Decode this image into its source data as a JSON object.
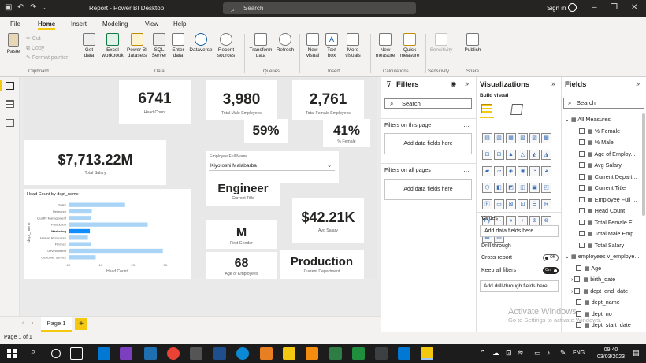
{
  "titlebar": {
    "title": "Report - Power BI Desktop",
    "search": "Search",
    "signin": "Sign in"
  },
  "menu": [
    "File",
    "Home",
    "Insert",
    "Modeling",
    "View",
    "Help"
  ],
  "ribbon": {
    "paste": "Paste",
    "cut": "Cut",
    "copy": "Copy",
    "format_painter": "Format painter",
    "get_data": "Get data",
    "excel": "Excel workbook",
    "pbi_datasets": "Power BI datasets",
    "sql": "SQL Server",
    "enter_data": "Enter data",
    "dataverse": "Dataverse",
    "recent": "Recent sources",
    "transform": "Transform data",
    "refresh": "Refresh",
    "new_visual": "New visual",
    "text_box": "Text box",
    "more_visuals": "More visuals",
    "new_measure": "New measure",
    "quick_measure": "Quick measure",
    "sensitivity": "Sensitivity",
    "publish": "Publish",
    "groups": {
      "clipboard": "Clipboard",
      "data": "Data",
      "queries": "Queries",
      "insert": "Insert",
      "calculations": "Calculations",
      "sensitivity": "Sensitivity",
      "share": "Share"
    }
  },
  "cards": {
    "head_count": {
      "value": "6741",
      "label": "Head Count"
    },
    "male": {
      "value": "3,980",
      "label": "Total Male Employees"
    },
    "female": {
      "value": "2,761",
      "label": "Total Female Employees"
    },
    "male_pct": {
      "value": "59%"
    },
    "female_pct": {
      "value": "41%",
      "label": "% Female"
    },
    "salary": {
      "value": "$7,713.22M",
      "label": "Total Salary"
    },
    "employee_name": {
      "label": "Employee Full Name",
      "value": "Kiyotoshi Malabarba"
    },
    "title": {
      "value": "Engineer",
      "label": "Current Title"
    },
    "avg_salary": {
      "value": "$42.21K",
      "label": "Avg Salary"
    },
    "gender": {
      "value": "M",
      "label": "First Gender"
    },
    "age": {
      "value": "68",
      "label": "Age of Employees"
    },
    "dept": {
      "value": "Production",
      "label": "Current Department"
    }
  },
  "chart_data": {
    "type": "bar",
    "title": "Head Count by dept_name",
    "ylabel": "dept_name",
    "xlabel": "Head Count",
    "categories": [
      "Sales",
      "Research",
      "Quality Management",
      "Production",
      "Marketing",
      "Human Resources",
      "Finance",
      "Development",
      "Customer Service"
    ],
    "values": [
      1750,
      720,
      700,
      2450,
      660,
      600,
      690,
      2920,
      840
    ],
    "highlight": "Marketing",
    "xticks": [
      "0K",
      "1K",
      "2K",
      "3K"
    ],
    "xlim": [
      0,
      3000
    ],
    "colors": {
      "bar": "#a9d4f5",
      "highlight": "#118dff"
    }
  },
  "pages": {
    "tab": "Page 1",
    "add": "+",
    "status": "Page 1 of 1"
  },
  "filters": {
    "title": "Filters",
    "search": "Search",
    "on_page": "Filters on this page",
    "on_all": "Filters on all pages",
    "add": "Add data fields here"
  },
  "visualizations": {
    "title": "Visualizations",
    "build": "Build visual",
    "values": "Values",
    "add": "Add data fields here",
    "drill": "Drill through",
    "cross_report": "Cross-report",
    "off": "Off",
    "keep_filters": "Keep all filters",
    "on": "On",
    "add_drill": "Add drill-through fields here"
  },
  "fields": {
    "title": "Fields",
    "search": "Search",
    "measures_group": "All Measures",
    "measures": [
      "% Female",
      "% Male",
      "Age of Employ...",
      "Avg Salary",
      "Current Depart...",
      "Current Title",
      "Employee Full ...",
      "Head Count",
      "Total Female E...",
      "Total Male Emp...",
      "Total Salary"
    ],
    "table_group": "employees v_employe...",
    "table": [
      "Age",
      "birth_date",
      "dept_end_date",
      "dept_name",
      "dept_no",
      "dept_start_date"
    ]
  },
  "watermark": {
    "line1": "Activate Windows",
    "line2": "Go to Settings to activate Windows."
  },
  "taskbar": {
    "lang": "ENG",
    "time": "09:40",
    "date": "03/03/2023"
  }
}
